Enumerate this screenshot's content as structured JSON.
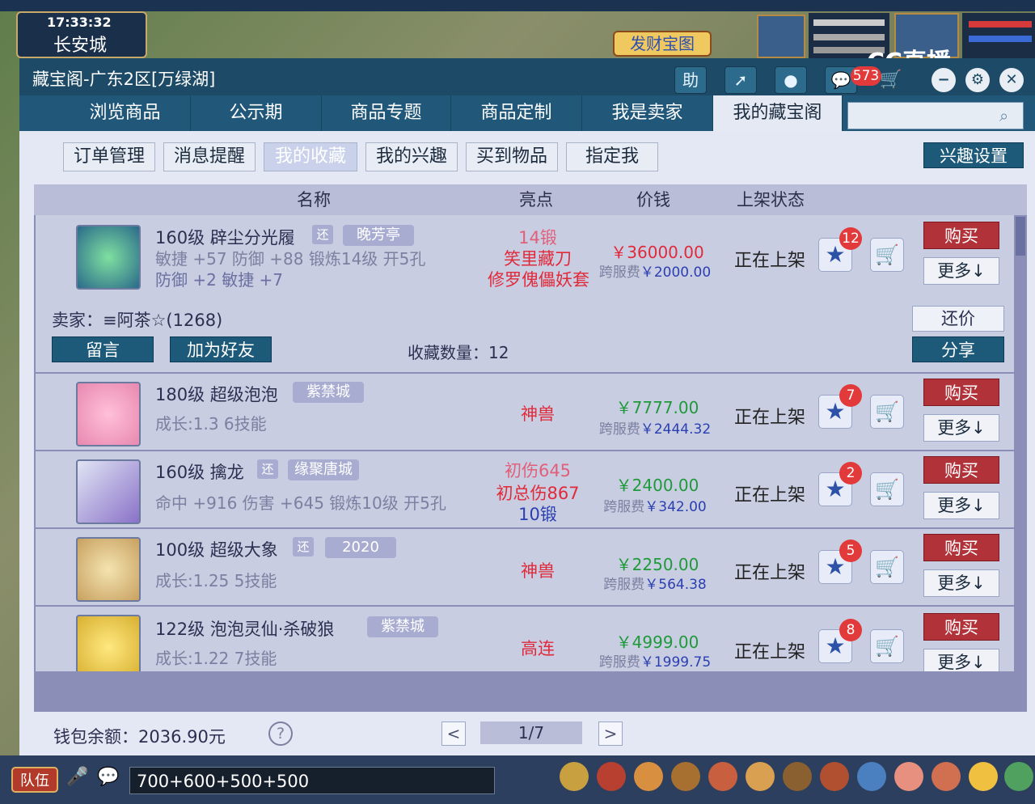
{
  "game": {
    "time": "17:33:32",
    "city": "长安城",
    "fortune_button": "发财宝图",
    "cc_logo": "CC直播",
    "team_label": "队伍",
    "chat_text": "700+600+500+500"
  },
  "window": {
    "title": "藏宝阁-广东2区[万绿湖]",
    "help_icon_label": "助",
    "message_count": "573"
  },
  "nav": {
    "tabs": [
      "浏览商品",
      "公示期",
      "商品专题",
      "商品定制",
      "我是卖家",
      "我的藏宝阁"
    ],
    "active_index": 5
  },
  "sub_tabs": {
    "items": [
      "订单管理",
      "消息提醒",
      "我的收藏",
      "我的兴趣",
      "买到物品",
      "指定我"
    ],
    "active_index": 2,
    "interest_settings": "兴趣设置"
  },
  "table": {
    "headers": [
      "名称",
      "亮点",
      "价钱",
      "上架状态"
    ],
    "rows": [
      {
        "name": "160级 辟尘分光履",
        "huan": "还",
        "server": "晚芳亭",
        "detail1": "敏捷 +57 防御 +88 锻炼14级 开5孔",
        "detail2": "防御 +2 敏捷 +7",
        "highlights": [
          "14锻",
          "笑里藏刀",
          "修罗傀儡妖套"
        ],
        "price": "￥36000.00",
        "fee_label": "跨服费",
        "fee": "￥2000.00",
        "status": "正在上架",
        "fav_count": "12",
        "buy": "购买",
        "more": "更多↓"
      },
      {
        "name": "180级 超级泡泡",
        "server": "紫禁城",
        "detail1": "成长:1.3 6技能",
        "highlights": [
          "神兽"
        ],
        "price": "￥7777.00",
        "fee_label": "跨服费",
        "fee": "￥2444.32",
        "status": "正在上架",
        "fav_count": "7",
        "buy": "购买",
        "more": "更多↓"
      },
      {
        "name": "160级 擒龙",
        "huan": "还",
        "server": "缘聚唐城",
        "detail1": "命中 +916 伤害 +645 锻炼10级 开5孔",
        "highlights": [
          "初伤645",
          "初总伤867",
          "10锻"
        ],
        "price": "￥2400.00",
        "fee_label": "跨服费",
        "fee": "￥342.00",
        "status": "正在上架",
        "fav_count": "2",
        "buy": "购买",
        "more": "更多↓"
      },
      {
        "name": "100级 超级大象",
        "huan": "还",
        "server": "2020",
        "detail1": "成长:1.25 5技能",
        "highlights": [
          "神兽"
        ],
        "price": "￥2250.00",
        "fee_label": "跨服费",
        "fee": "￥564.38",
        "status": "正在上架",
        "fav_count": "5",
        "buy": "购买",
        "more": "更多↓"
      },
      {
        "name": "122级 泡泡灵仙·杀破狼",
        "server": "紫禁城",
        "detail1": "成长:1.22 7技能",
        "highlights": [
          "高连"
        ],
        "price": "￥4999.00",
        "fee_label": "跨服费",
        "fee": "￥1999.75",
        "status": "正在上架",
        "fav_count": "8",
        "buy": "购买",
        "more": "更多↓"
      }
    ],
    "seller": {
      "label": "卖家：≡阿茶☆(1268)",
      "message_button": "留言",
      "add_friend_button": "加为好友",
      "fav_label": "收藏数量：12",
      "counter_offer_button": "还价",
      "share_button": "分享"
    }
  },
  "footer": {
    "wallet": "钱包余额：2036.90元",
    "help": "?",
    "prev": "<",
    "page": "1/7",
    "next": ">"
  },
  "colors": {
    "window_bg": "#1d4a66",
    "row_bg": "#c9cde2",
    "buy_button": "#b2323a",
    "price_green": "#1e9a3a",
    "highlight_red": "#e02a3a",
    "highlight_blue": "#2a3fb0"
  }
}
